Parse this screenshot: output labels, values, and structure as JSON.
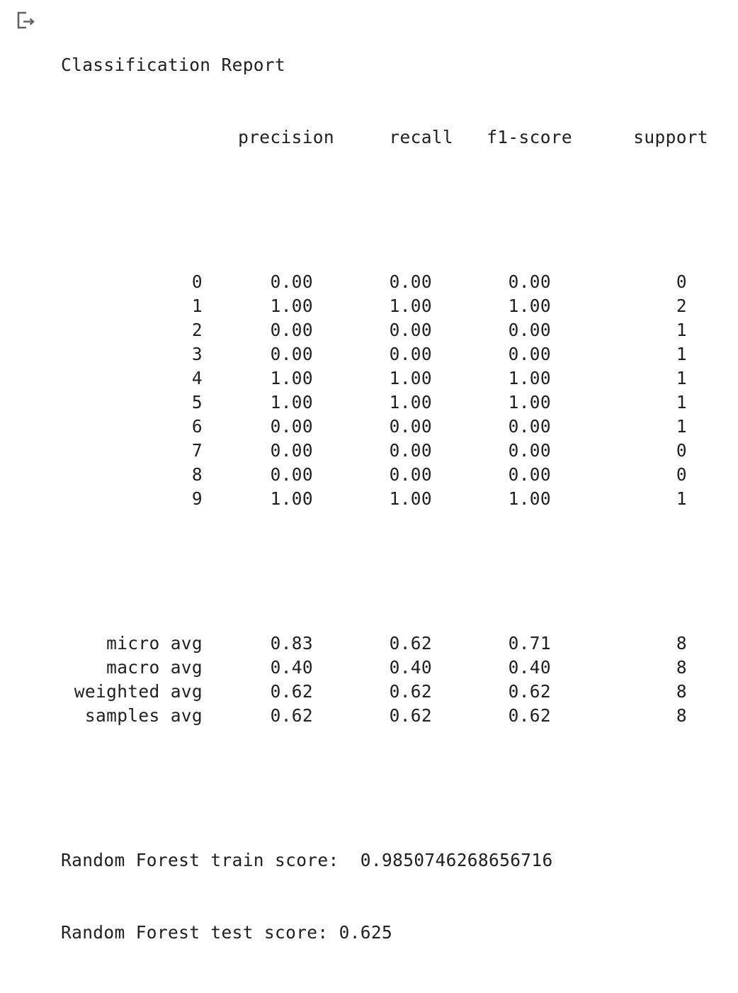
{
  "output": {
    "title": "Classification Report",
    "headers": {
      "precision": "precision",
      "recall": "recall",
      "f1": "f1-score",
      "support": "support"
    },
    "classes": [
      {
        "label": "0",
        "precision": "0.00",
        "recall": "0.00",
        "f1": "0.00",
        "support": "0"
      },
      {
        "label": "1",
        "precision": "1.00",
        "recall": "1.00",
        "f1": "1.00",
        "support": "2"
      },
      {
        "label": "2",
        "precision": "0.00",
        "recall": "0.00",
        "f1": "0.00",
        "support": "1"
      },
      {
        "label": "3",
        "precision": "0.00",
        "recall": "0.00",
        "f1": "0.00",
        "support": "1"
      },
      {
        "label": "4",
        "precision": "1.00",
        "recall": "1.00",
        "f1": "1.00",
        "support": "1"
      },
      {
        "label": "5",
        "precision": "1.00",
        "recall": "1.00",
        "f1": "1.00",
        "support": "1"
      },
      {
        "label": "6",
        "precision": "0.00",
        "recall": "0.00",
        "f1": "0.00",
        "support": "1"
      },
      {
        "label": "7",
        "precision": "0.00",
        "recall": "0.00",
        "f1": "0.00",
        "support": "0"
      },
      {
        "label": "8",
        "precision": "0.00",
        "recall": "0.00",
        "f1": "0.00",
        "support": "0"
      },
      {
        "label": "9",
        "precision": "1.00",
        "recall": "1.00",
        "f1": "1.00",
        "support": "1"
      }
    ],
    "averages": [
      {
        "label": "micro avg",
        "precision": "0.83",
        "recall": "0.62",
        "f1": "0.71",
        "support": "8"
      },
      {
        "label": "macro avg",
        "precision": "0.40",
        "recall": "0.40",
        "f1": "0.40",
        "support": "8"
      },
      {
        "label": "weighted avg",
        "precision": "0.62",
        "recall": "0.62",
        "f1": "0.62",
        "support": "8"
      },
      {
        "label": "samples avg",
        "precision": "0.62",
        "recall": "0.62",
        "f1": "0.62",
        "support": "8"
      }
    ],
    "scores": {
      "train_line": "Random Forest train score:  0.9850746268656716",
      "test_line": "Random Forest test score: 0.625"
    }
  },
  "icons": {
    "output_icon": "output-redirect-icon"
  },
  "colors": {
    "text": "#212121",
    "icon": "#616161",
    "background": "#ffffff"
  }
}
